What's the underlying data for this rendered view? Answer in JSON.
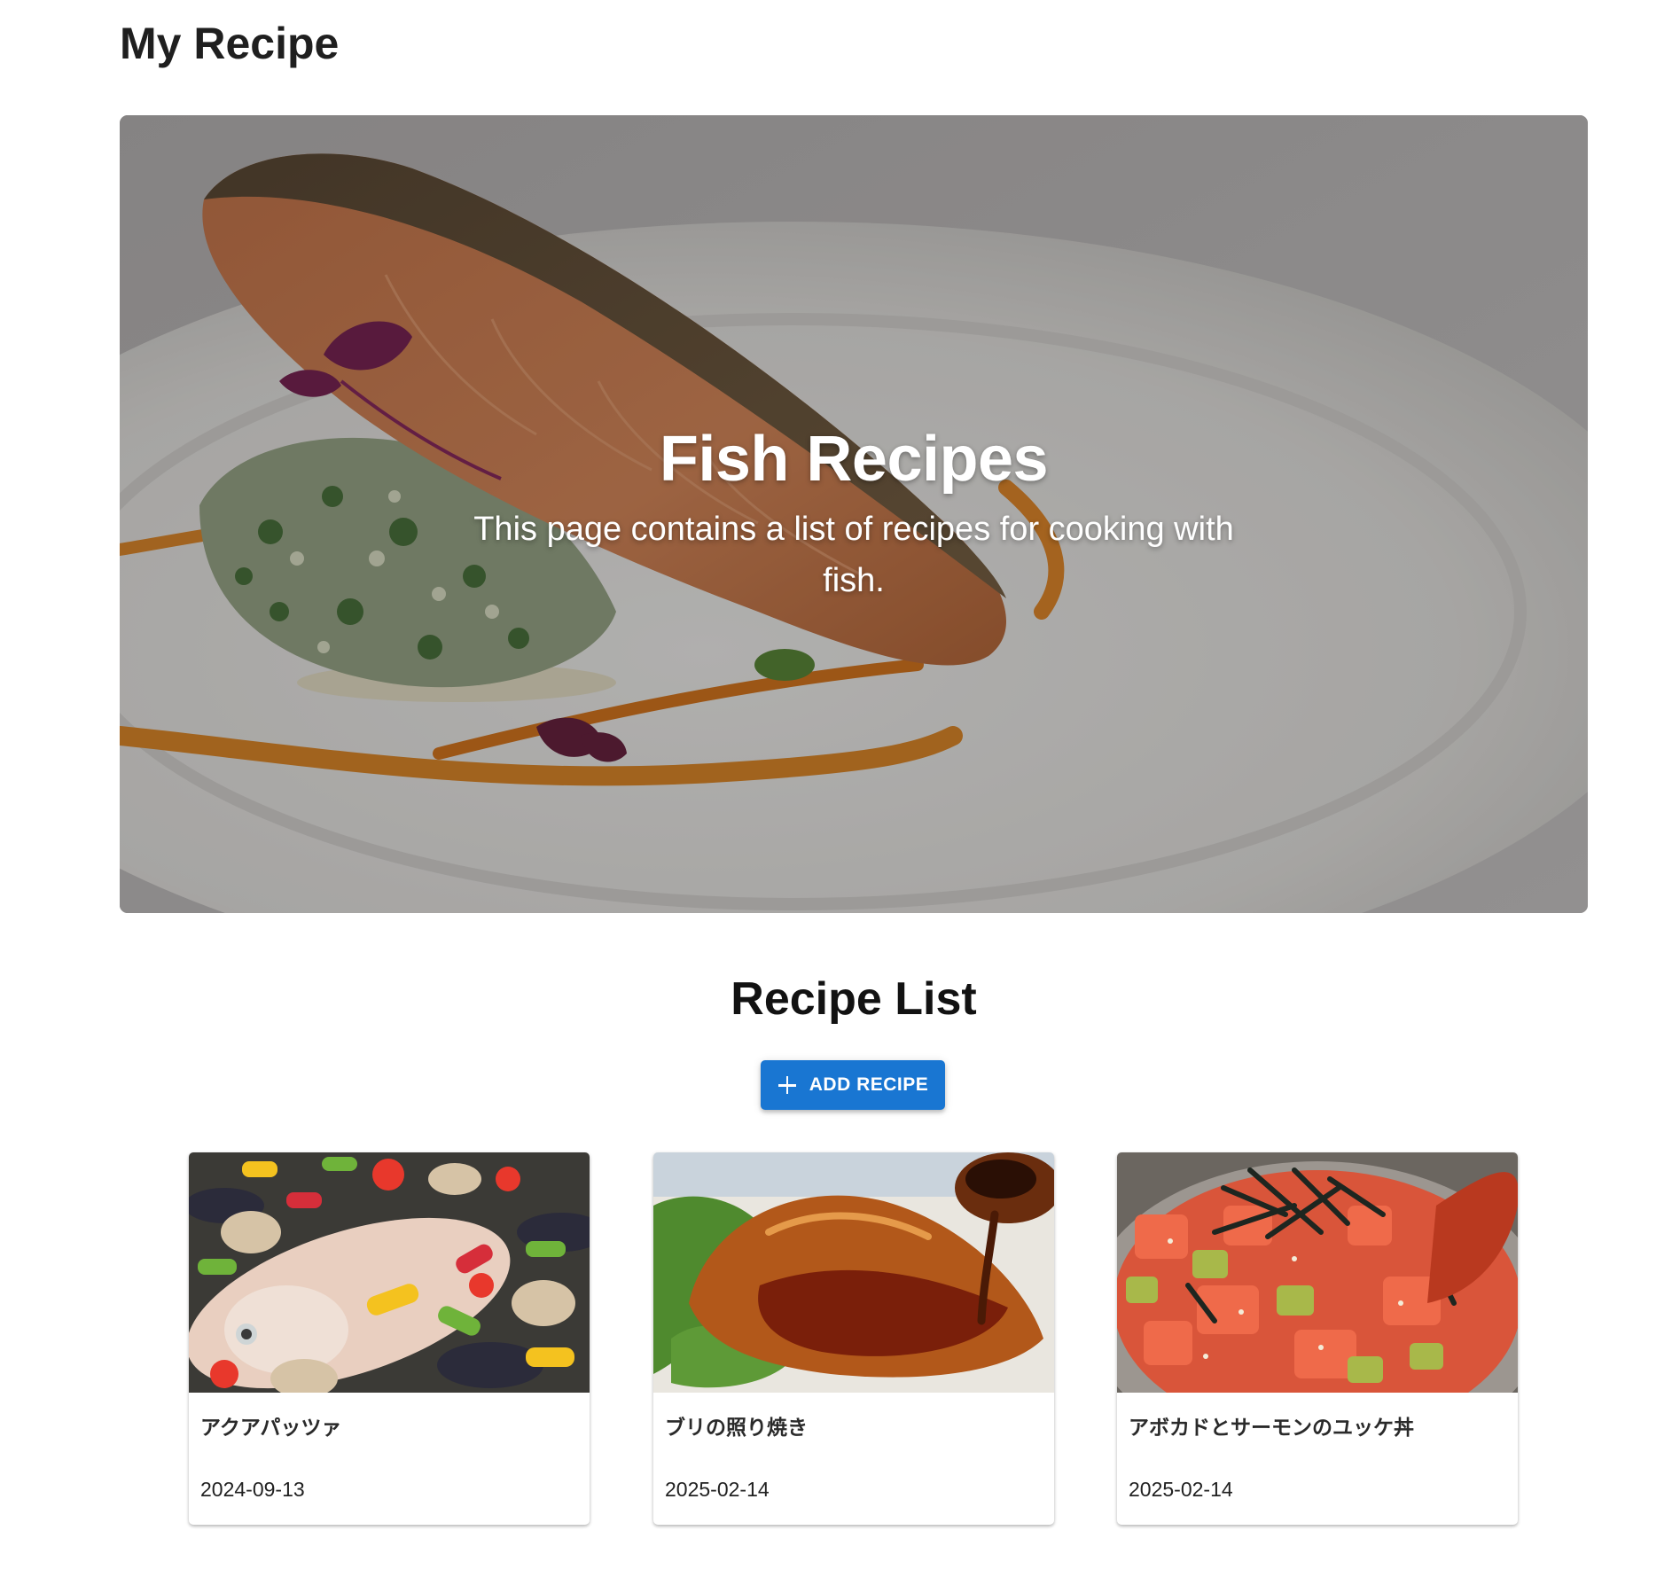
{
  "app": {
    "title": "My Recipe"
  },
  "hero": {
    "title": "Fish Recipes",
    "description": "This page contains a list of recipes for cooking with fish.",
    "image_icon": "salmon-fillet-image"
  },
  "recipe_list": {
    "heading": "Recipe List",
    "add_button_label": "ADD RECIPE",
    "add_button_icon": "plus-icon",
    "accent_color": "#1976d2",
    "items": [
      {
        "title": "アクアパッツァ",
        "date": "2024-09-13",
        "image_icon": "acqua-pazza-image"
      },
      {
        "title": "ブリの照り焼き",
        "date": "2025-02-14",
        "image_icon": "teriyaki-yellowtail-image"
      },
      {
        "title": "アボカドとサーモンのユッケ丼",
        "date": "2025-02-14",
        "image_icon": "salmon-avocado-bowl-image"
      }
    ]
  }
}
